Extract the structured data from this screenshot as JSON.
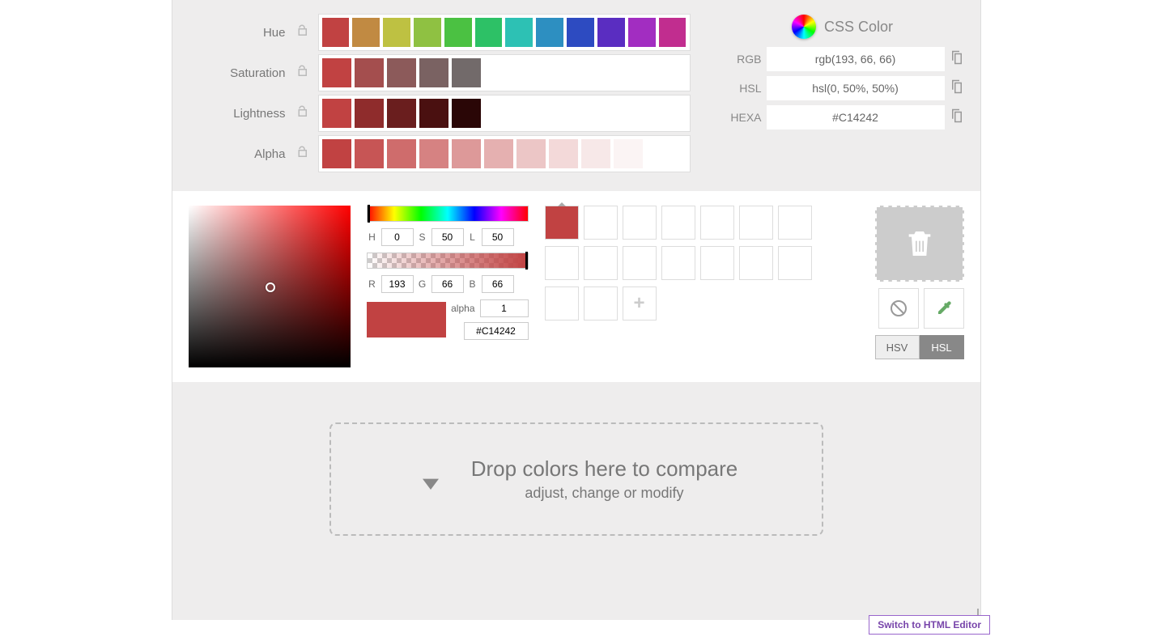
{
  "sliders": {
    "hue": {
      "label": "Hue",
      "swatches": [
        "#C14242",
        "#C18A42",
        "#BEC142",
        "#8FC142",
        "#4BC142",
        "#2DC166",
        "#2DC1B4",
        "#2D8FC1",
        "#2D4BC1",
        "#5A2DC1",
        "#A22DC1",
        "#C12D8F"
      ]
    },
    "saturation": {
      "label": "Saturation",
      "swatches": [
        "#C14242",
        "#A44E4E",
        "#8C5A5A",
        "#7A6262",
        "#726A6A"
      ]
    },
    "lightness": {
      "label": "Lightness",
      "swatches": [
        "#C14242",
        "#8F2C2C",
        "#6A1E1E",
        "#4A1010",
        "#2A0606"
      ]
    },
    "alpha": {
      "label": "Alpha",
      "swatches": [
        "#C14242",
        "rgba(193,66,66,.9)",
        "rgba(193,66,66,.78)",
        "rgba(193,66,66,.66)",
        "rgba(193,66,66,.54)",
        "rgba(193,66,66,.42)",
        "rgba(193,66,66,.3)",
        "rgba(193,66,66,.2)",
        "rgba(193,66,66,.12)",
        "rgba(193,66,66,.06)"
      ]
    }
  },
  "css": {
    "title": "CSS Color",
    "rgb_label": "RGB",
    "rgb": "rgb(193, 66, 66)",
    "hsl_label": "HSL",
    "hsl": "hsl(0, 50%, 50%)",
    "hexa_label": "HEXA",
    "hexa": "#C14242"
  },
  "picker": {
    "h_label": "H",
    "h": "0",
    "s_label": "S",
    "s": "50",
    "l_label": "L",
    "l": "50",
    "r_label": "R",
    "r": "193",
    "g_label": "G",
    "g": "66",
    "b_label": "B",
    "b": "66",
    "alpha_label": "alpha",
    "alpha": "1",
    "hex": "#C14242",
    "preview_color": "#C14242"
  },
  "palette": {
    "filled_color": "#C14242"
  },
  "modes": {
    "hsv": "HSV",
    "hsl": "HSL",
    "active": "HSL"
  },
  "drop": {
    "title": "Drop colors here to compare",
    "sub": "adjust, change or modify"
  },
  "footer": {
    "switch": "Switch to HTML Editor"
  }
}
